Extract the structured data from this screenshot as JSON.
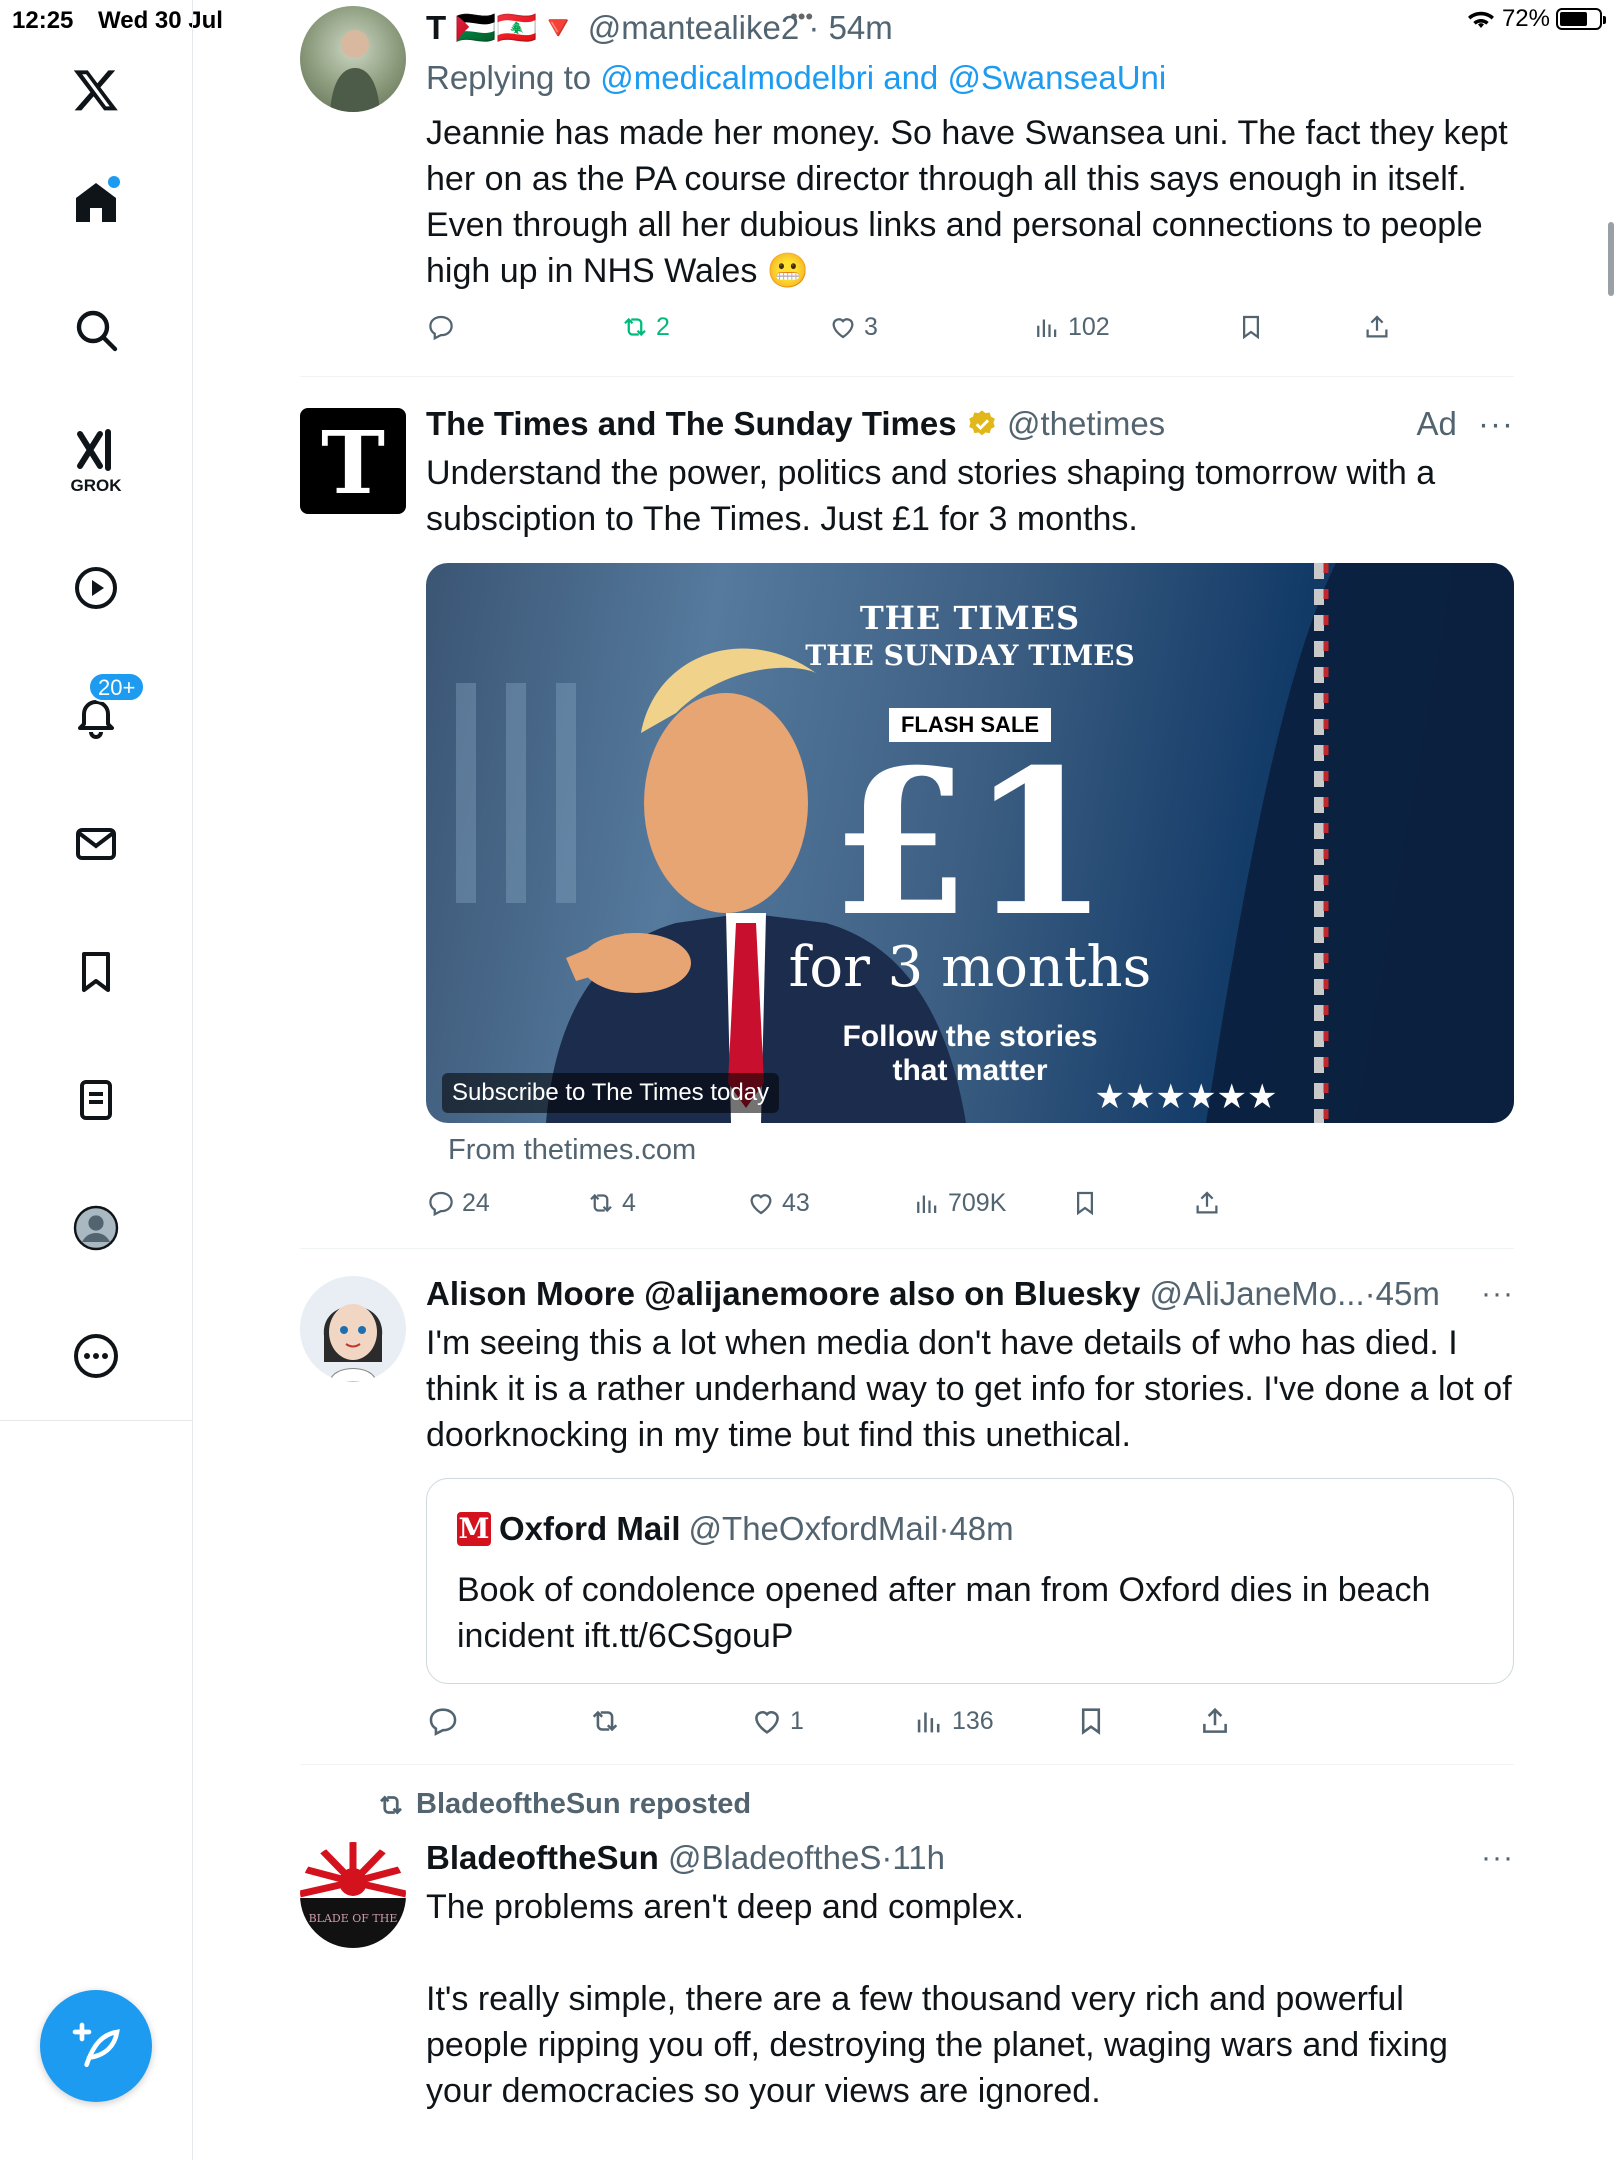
{
  "status_bar": {
    "time": "12:25",
    "date": "Wed 30 Jul",
    "battery": "72%",
    "center_dots": "•••"
  },
  "sidebar": {
    "items": [
      {
        "icon": "x-logo-icon"
      },
      {
        "icon": "home-icon"
      },
      {
        "icon": "search-icon"
      },
      {
        "icon": "grok-icon",
        "label": "GROK"
      },
      {
        "icon": "play-icon"
      },
      {
        "icon": "bell-icon",
        "badge": "20+"
      },
      {
        "icon": "mail-icon"
      },
      {
        "icon": "bookmark-icon"
      },
      {
        "icon": "list-icon"
      },
      {
        "icon": "profile-icon"
      },
      {
        "icon": "more-icon"
      }
    ],
    "compose_icon": "compose-icon"
  },
  "tweets": [
    {
      "name": "T 🇵🇸🇱🇧🔻",
      "handle": "@mantealike2",
      "time": "54m",
      "separator": "·",
      "replying_prefix": "Replying to",
      "replying_to_1": "@medicalmodelbri",
      "replying_and": "and",
      "replying_to_2": "@SwanseaUni",
      "text": "Jeannie has made her money. So have Swansea uni. The fact they kept her on as the PA course director through all this says enough in itself. Even through all her dubious links and personal connections to people high up in NHS Wales 😬",
      "replies": "",
      "reposts": "2",
      "likes": "3",
      "views": "102"
    },
    {
      "name": "The Times and The Sunday Times",
      "handle": "@thetimes",
      "ad_label": "Ad",
      "text": "Understand the power, politics and stories shaping tomorrow with a subsciption to The Times. Just £1 for 3 months.",
      "image": {
        "masthead_1": "THE  TIMES",
        "masthead_2": "THE SUNDAY TIMES",
        "flash_sale": "FLASH SALE",
        "price": "£1",
        "duration": "for 3 months",
        "tagline_1": "Follow the stories",
        "tagline_2": "that matter",
        "cta": "Subscribe to The Times today"
      },
      "from": "From thetimes.com",
      "replies": "24",
      "reposts": "4",
      "likes": "43",
      "views": "709K"
    },
    {
      "name": "Alison Moore @alijanemoore also on Bluesky",
      "handle": "@AliJaneMo...",
      "time": "45m",
      "separator": "·",
      "text": "I'm seeing this a lot when media don't have details of who has died. I think it is a rather underhand way to get info for stories. I've done a lot of doorknocking in my time but find this unethical.",
      "quote": {
        "logo": "M",
        "name": "Oxford Mail",
        "handle": "@TheOxfordMail",
        "time": "48m",
        "text": "Book of condolence opened after man from Oxford dies in beach incident ift.tt/6CSgouP"
      },
      "replies": "",
      "reposts": "",
      "likes": "1",
      "views": "136"
    },
    {
      "repost_label": "BladeoftheSun reposted",
      "name": "BladeoftheSun",
      "handle": "@BladeoftheS",
      "time": "11h",
      "separator": "·",
      "text_1": "The problems aren't deep and complex.",
      "text_2": "It's really simple, there are a few thousand very rich and powerful people ripping you off, destroying the planet, waging wars and fixing your democracies so your views are ignored.",
      "avatar_text": "BLADE OF THE"
    }
  ],
  "colors": {
    "accent": "#1d9bf0",
    "secondary_text": "#536471",
    "retweet_green": "#00ba7c",
    "times_black": "#000000",
    "oxford_red": "#d4121e"
  }
}
